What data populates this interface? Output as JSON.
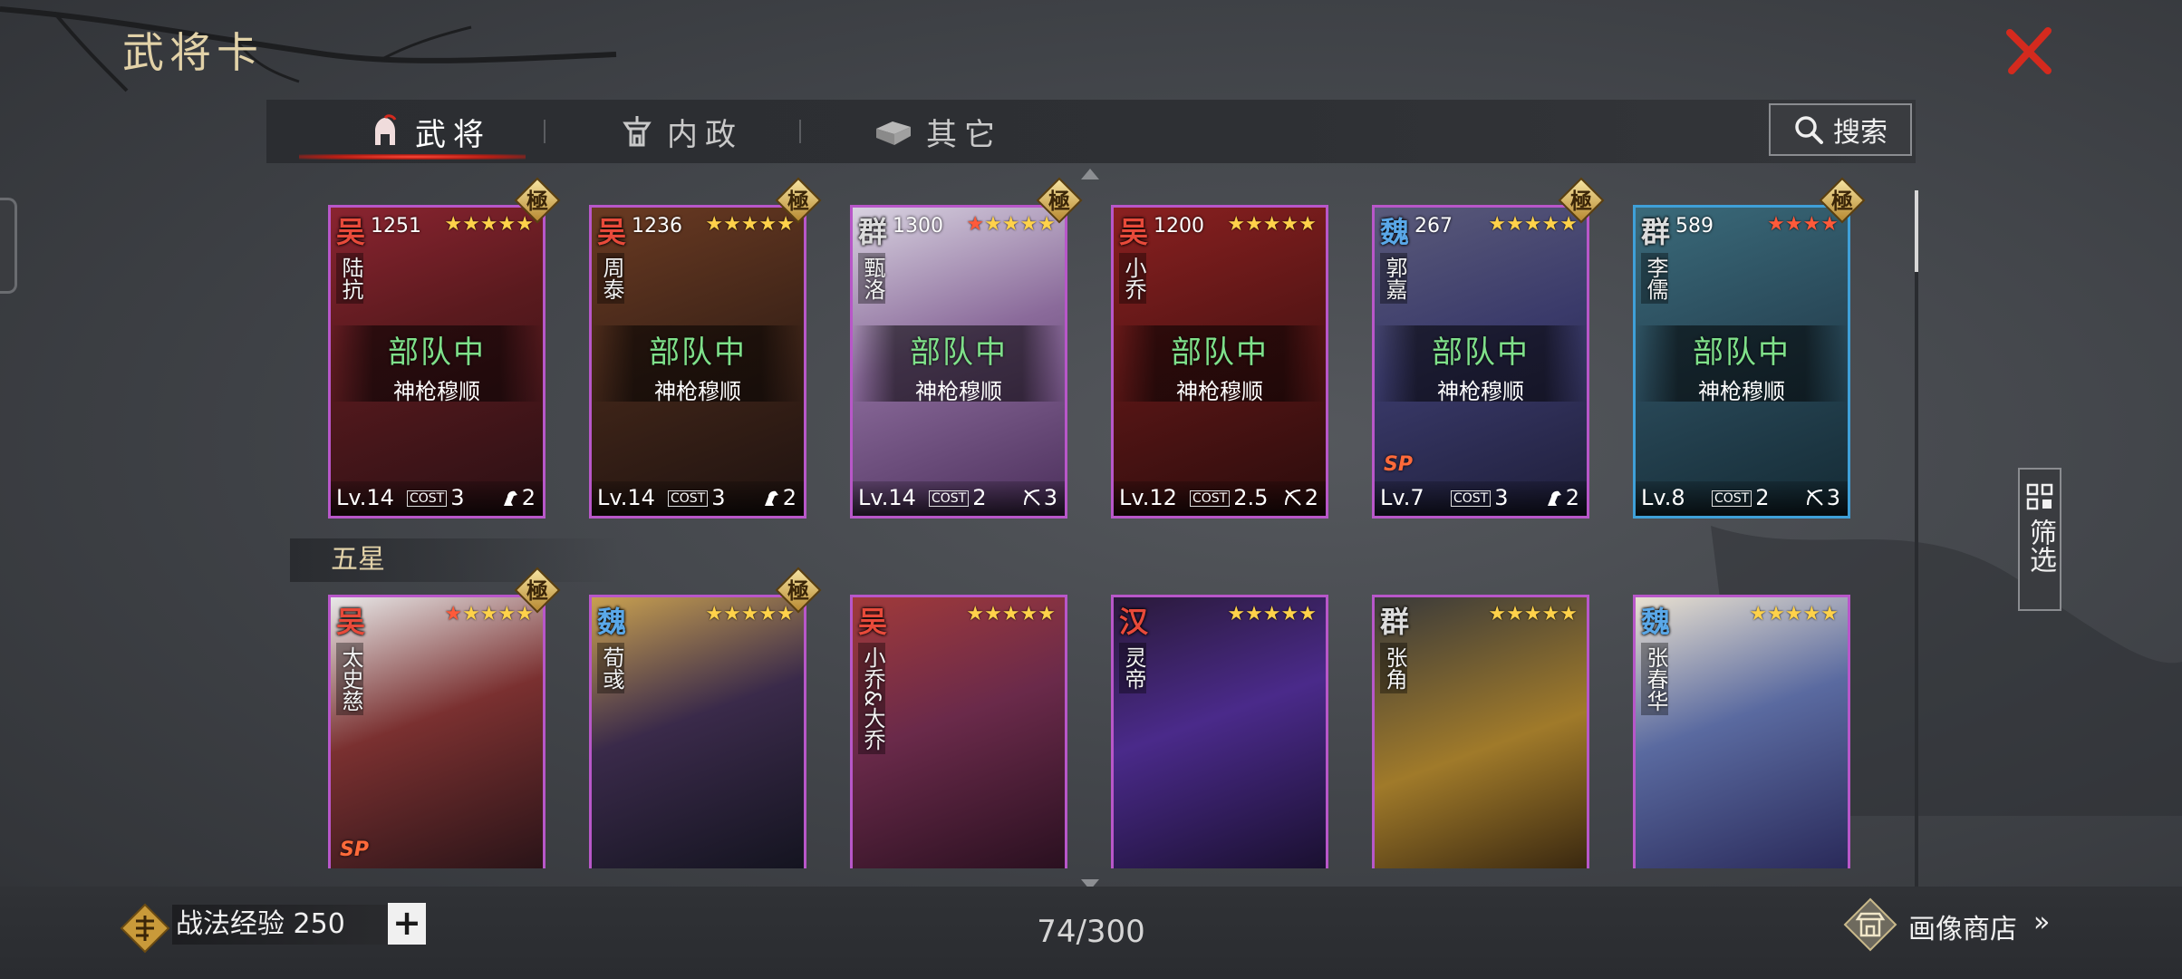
{
  "title": "武将卡",
  "tabs": [
    {
      "label": "武将",
      "icon": "helmet-icon",
      "active": true
    },
    {
      "label": "内政",
      "icon": "tower-icon",
      "active": false
    },
    {
      "label": "其它",
      "icon": "chest-icon",
      "active": false
    }
  ],
  "search": {
    "label": "搜索"
  },
  "filter": {
    "label": "筛选"
  },
  "section_label": "五星",
  "row1": [
    {
      "faction": "吴",
      "faction_color": "#e84a3a",
      "power": "1251",
      "stars": 5,
      "red_stars": 0,
      "name": "陆抗",
      "status": "部队中",
      "squad": "神枪穆顺",
      "level": "Lv.14",
      "cost": "3",
      "range": "2",
      "range_icon": "horse-icon",
      "badge": "極",
      "border": "purple"
    },
    {
      "faction": "吴",
      "faction_color": "#e84a3a",
      "power": "1236",
      "stars": 5,
      "red_stars": 0,
      "name": "周泰",
      "status": "部队中",
      "squad": "神枪穆顺",
      "level": "Lv.14",
      "cost": "3",
      "range": "2",
      "range_icon": "horse-icon",
      "badge": "極",
      "border": "purple"
    },
    {
      "faction": "群",
      "faction_color": "#dcdcdc",
      "power": "1300",
      "stars": 5,
      "red_stars": 1,
      "name": "甄洛",
      "status": "部队中",
      "squad": "神枪穆顺",
      "level": "Lv.14",
      "cost": "2",
      "range": "3",
      "range_icon": "bow-icon",
      "badge": "極",
      "border": "purple"
    },
    {
      "faction": "吴",
      "faction_color": "#e84a3a",
      "power": "1200",
      "stars": 5,
      "red_stars": 0,
      "name": "小乔",
      "status": "部队中",
      "squad": "神枪穆顺",
      "level": "Lv.12",
      "cost": "2.5",
      "range": "2",
      "range_icon": "bow-icon",
      "badge": "",
      "border": "purple"
    },
    {
      "faction": "魏",
      "faction_color": "#5aa8e8",
      "power": "267",
      "stars": 5,
      "red_stars": 0,
      "name": "郭嘉",
      "status": "部队中",
      "squad": "神枪穆顺",
      "level": "Lv.7",
      "cost": "3",
      "range": "2",
      "range_icon": "horse-icon",
      "badge": "極",
      "border": "purple",
      "sp": "SP"
    },
    {
      "faction": "群",
      "faction_color": "#dcdcdc",
      "power": "589",
      "stars": 4,
      "red_stars": 4,
      "name": "李儒",
      "status": "部队中",
      "squad": "神枪穆顺",
      "level": "Lv.8",
      "cost": "2",
      "range": "3",
      "range_icon": "bow-icon",
      "badge": "極",
      "border": "blue"
    }
  ],
  "row2": [
    {
      "faction": "吴",
      "faction_color": "#e84a3a",
      "stars": 5,
      "red_stars": 1,
      "name": "太史慈",
      "badge": "極",
      "sp": "SP"
    },
    {
      "faction": "魏",
      "faction_color": "#5aa8e8",
      "stars": 5,
      "red_stars": 0,
      "name": "荀彧",
      "badge": "極"
    },
    {
      "faction": "吴",
      "faction_color": "#e84a3a",
      "stars": 5,
      "red_stars": 0,
      "name": "小乔&大乔",
      "badge": ""
    },
    {
      "faction": "汉",
      "faction_color": "#e84a3a",
      "stars": 5,
      "red_stars": 0,
      "name": "灵帝",
      "badge": ""
    },
    {
      "faction": "群",
      "faction_color": "#dcdcdc",
      "stars": 5,
      "red_stars": 0,
      "name": "张角",
      "badge": ""
    },
    {
      "faction": "魏",
      "faction_color": "#5aa8e8",
      "stars": 5,
      "red_stars": 0,
      "name": "张春华",
      "badge": ""
    }
  ],
  "bottom": {
    "exp_label": "战法经验 250",
    "plus": "+",
    "count": "74/300",
    "shop_label": "画像商店",
    "shop_arrow": "»"
  },
  "cost_prefix": "COST",
  "colors": {
    "accent_red": "#d42a1e",
    "gold": "#e2d2a8",
    "card_border_purple": "#b857c9",
    "card_border_blue": "#3fa0d8",
    "status_green": "#7fe08a"
  }
}
